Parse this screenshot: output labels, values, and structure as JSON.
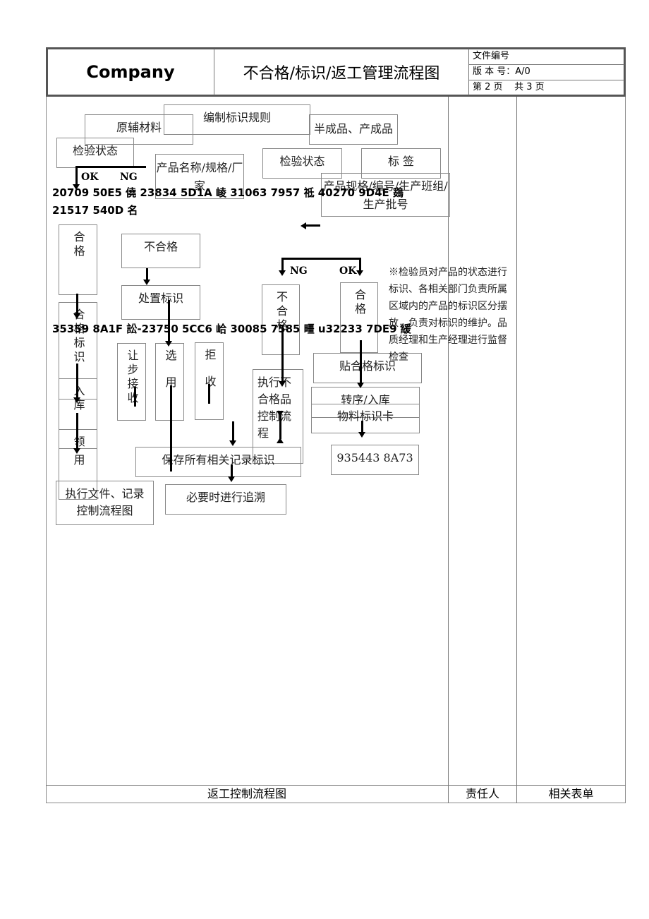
{
  "header": {
    "company": "Company",
    "title": "不合格/标识/返工管理流程图",
    "doc_number_label": "文件编号",
    "version_label": "版 本 号：A/0",
    "page_label": "第 2 页    共 3 页"
  },
  "flow": {
    "boxes": {
      "rule": "编制标识规则",
      "raw": "原辅材料",
      "semi": "半成品、产成品",
      "inspect_left": "检验状态",
      "product_name": "产品名称/规格/厂家",
      "inspect_mid": "检验状态",
      "tag": "标 签",
      "product_spec": "产品规格/编号/生产班组/生产批号",
      "pass_left": "合格",
      "fail": "不合格",
      "handle": "处置标识",
      "pass_mark": "合格标识",
      "concession": "让步接收",
      "select": "选用",
      "reject": "拒收",
      "fail_mid": "不合格",
      "pass_mid": "合格",
      "exec_ncr": "执行不合格品控制流程",
      "attach_pass": "贴合格标识",
      "transfer": "转序/入库",
      "material_card": "物料标识卡",
      "garbled_box": "935443 8A73",
      "storage": "入库",
      "use": "领用",
      "keep_records": "保存所有相关记录标识",
      "exec_doc": "执行文件、记录控制流程图",
      "trace": "必要时进行追溯"
    },
    "labels": {
      "ok_top": "OK",
      "ng_top": "NG",
      "ng_mid": "NG",
      "ok_mid": "OK"
    },
    "garbled_line1": "20709 50E5 僥 23834 5D1A 崚 31063 7957 祗 40270 9D4E 鵎",
    "garbled_line2": "21517 540D 名",
    "garbled_line3": "35359 8A1F 訟-23750 5CC6 峆 30085 7585 疅 u32233 7DE9 緩",
    "note": "※检验员对产品的状态进行标识、各相关部门负责所属区域内的产品的标识区分摆放，负责对标识的维护。品质经理和生产经理进行监督检查"
  },
  "footer": {
    "flow_title": "返工控制流程图",
    "responsible": "责任人",
    "forms": "相关表单"
  }
}
